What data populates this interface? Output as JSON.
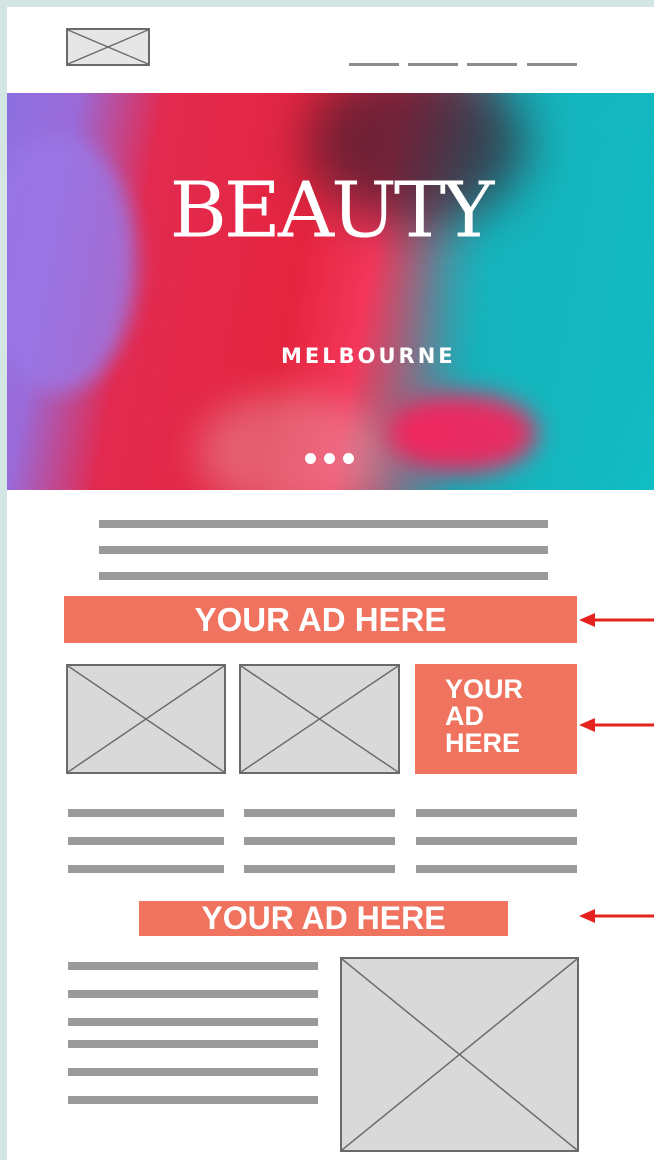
{
  "header": {
    "logo_icon": "image-placeholder-icon",
    "nav_items": 4
  },
  "hero": {
    "title": "BEAUTY",
    "subtitle": "MELBOURNE",
    "carousel_dots": 3
  },
  "ads": {
    "banner_top": "YOUR AD HERE",
    "square_lines": [
      "YOUR",
      "AD",
      "HERE"
    ],
    "banner_bottom": "YOUR AD HERE",
    "color": "#f0735f"
  },
  "arrow_color": "#e52420"
}
